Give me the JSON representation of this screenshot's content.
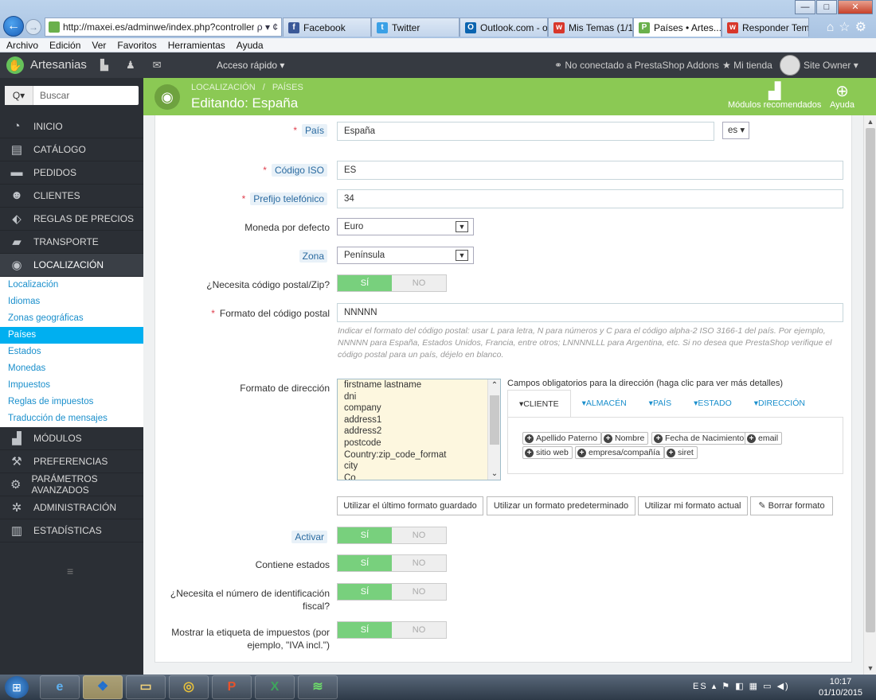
{
  "browser": {
    "url": "http://maxei.es/adminwe/index.php?controller=",
    "address_tools": "ρ ▾ ¢",
    "tabs": [
      {
        "label": "Facebook",
        "icon": "facebook-icon",
        "color": "#3b5998",
        "glyph": "f"
      },
      {
        "label": "Twitter",
        "icon": "twitter-icon",
        "color": "#3aa0e6",
        "glyph": "t"
      },
      {
        "label": "Outlook.com - o...",
        "icon": "outlook-icon",
        "color": "#0a64b0",
        "glyph": "O"
      },
      {
        "label": "Mis Temas (1/1)",
        "icon": "theme-forum-icon",
        "color": "#d8372b",
        "glyph": "w"
      },
      {
        "label": "Países • Artes...",
        "icon": "prestashop-icon",
        "color": "#6ab04c",
        "glyph": "P",
        "active": true
      },
      {
        "label": "Responder Tema...",
        "icon": "theme-forum-icon",
        "color": "#d8372b",
        "glyph": "w"
      }
    ],
    "menu": [
      "Archivo",
      "Edición",
      "Ver",
      "Favoritos",
      "Herramientas",
      "Ayuda"
    ],
    "window_buttons": [
      "—",
      "□",
      "✕"
    ],
    "right_icons": "⌂☆⚙"
  },
  "adminbar": {
    "shop_name": "Artesanias",
    "quick_access": "Acceso rápido ▾",
    "addons": "No conectado a PrestaShop Addons",
    "my_shop": "Mi tienda",
    "owner": "Site Owner ▾"
  },
  "sidebar": {
    "search_button": "Q▾",
    "search_placeholder": "Buscar",
    "items": [
      {
        "label": "Inicio",
        "icon": "dashboard-icon",
        "glyph": "◔"
      },
      {
        "label": "Catálogo",
        "icon": "catalog-icon",
        "glyph": "▤"
      },
      {
        "label": "Pedidos",
        "icon": "orders-icon",
        "glyph": "▬"
      },
      {
        "label": "Clientes",
        "icon": "customers-icon",
        "glyph": "☻"
      },
      {
        "label": "Reglas de precios",
        "icon": "price-tag-icon",
        "glyph": "⬖"
      },
      {
        "label": "Transporte",
        "icon": "truck-icon",
        "glyph": "▰"
      },
      {
        "label": "Localización",
        "icon": "globe-icon",
        "glyph": "◉",
        "active": true
      }
    ],
    "subitems": [
      {
        "label": "Localización"
      },
      {
        "label": "Idiomas"
      },
      {
        "label": "Zonas geográficas"
      },
      {
        "label": "Países",
        "active": true
      },
      {
        "label": "Estados"
      },
      {
        "label": "Monedas"
      },
      {
        "label": "Impuestos"
      },
      {
        "label": "Reglas de impuestos"
      },
      {
        "label": "Traducción de mensajes"
      }
    ],
    "items_after": [
      {
        "label": "Módulos",
        "icon": "puzzle-icon",
        "glyph": "▟"
      },
      {
        "label": "Preferencias",
        "icon": "wrench-icon",
        "glyph": "⚒"
      },
      {
        "label": "Parámetros avanzados",
        "icon": "gears-icon",
        "glyph": "⚙"
      },
      {
        "label": "Administración",
        "icon": "cog-icon",
        "glyph": "✲"
      },
      {
        "label": "Estadísticas",
        "icon": "bar-chart-icon",
        "glyph": "▥"
      }
    ],
    "collapse_glyph": "≡"
  },
  "header": {
    "breadcrumb_1": "Localización",
    "breadcrumb_sep": "/",
    "breadcrumb_2": "Países",
    "title": "Editando: España",
    "tool_modules": "Módulos recomendados",
    "tool_help": "Ayuda"
  },
  "form": {
    "country_label": "País",
    "country_value": "España",
    "lang_select": "es ▾",
    "iso_label": "Código ISO",
    "iso_value": "ES",
    "prefix_label": "Prefijo telefónico",
    "prefix_value": "34",
    "currency_label": "Moneda por defecto",
    "currency_value": "Euro",
    "zone_label": "Zona",
    "zone_value": "Península",
    "zip_needed_label": "¿Necesita código postal/Zip?",
    "zip_format_label": "Formato del código postal",
    "zip_format_value": "NNNNN",
    "zip_help": "Indicar el formato del código postal: usar L para letra, N para números y C para el código alpha-2 ISO 3166-1 del país. Por ejemplo, NNNNN para España, Estados Unidos, Francia, entre otros; LNNNNLLL para Argentina, etc. Si no desea que PrestaShop verifique el código postal para un país, déjelo en blanco.",
    "address_format_label": "Formato de dirección",
    "address_lines": [
      "firstname lastname",
      "dni",
      "company",
      "address1",
      "address2",
      "postcode",
      "Country:zip_code_format",
      "city",
      "Co"
    ],
    "required_fields_title": "Campos obligatorios para la dirección (haga clic para ver más detalles)",
    "field_tabs": [
      "▾Cliente",
      "▾Almacén",
      "▾País",
      "▾Estado",
      "▾Dirección"
    ],
    "chips": [
      "Apellido Paterno",
      "Nombre",
      "Fecha de Nacimiento",
      "email",
      "sitio web",
      "empresa/compañía",
      "siret"
    ],
    "buttons": [
      "Utilizar el último formato guardado",
      "Utilizar un formato predeterminado",
      "Utilizar mi formato actual",
      "Borrar formato"
    ],
    "active_label": "Activar",
    "states_label": "Contiene estados",
    "taxid_label_1": "¿Necesita el número de identificación",
    "taxid_label_2": "fiscal?",
    "taxlabel_label_1": "Mostrar la etiqueta de impuestos (por",
    "taxlabel_label_2": "ejemplo, \"IVA incl.\")",
    "yes": "SÍ",
    "no": "NO"
  },
  "taskbar": {
    "apps": [
      {
        "icon": "internet-explorer-icon",
        "glyph": "e"
      },
      {
        "icon": "dropbox-icon",
        "glyph": "❖"
      },
      {
        "icon": "file-explorer-icon",
        "glyph": "▭"
      },
      {
        "icon": "chrome-icon",
        "glyph": "◎"
      },
      {
        "icon": "powerpoint-icon",
        "glyph": "P"
      },
      {
        "icon": "excel-icon",
        "glyph": "X"
      },
      {
        "icon": "spotify-icon",
        "glyph": "≋"
      }
    ],
    "tray": "ES ▴ ⚑ ◧ ▦ ▭ ◀)",
    "time": "10:17",
    "date": "01/10/2015"
  },
  "colors": {
    "header_green": "#8bc954",
    "sidebar_dark": "#2b2f35",
    "active_sub": "#00aff0",
    "toggle_on": "#78d07d",
    "required": "#e0404f"
  }
}
